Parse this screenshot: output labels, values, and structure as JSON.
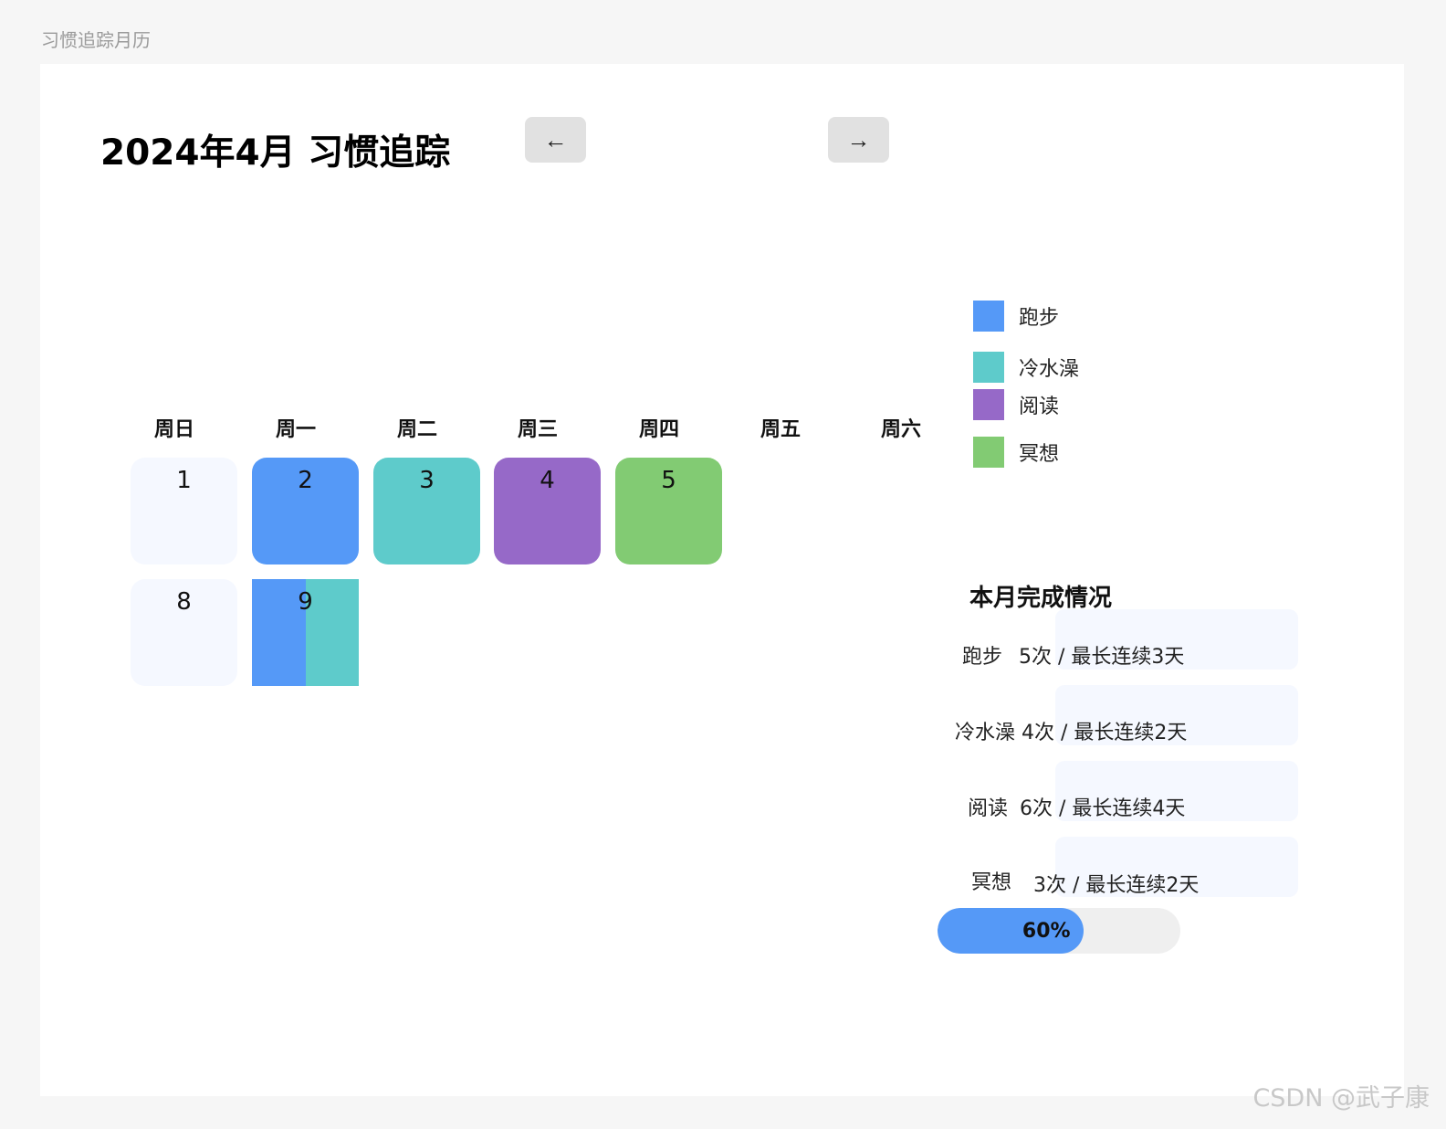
{
  "window_title": "习惯追踪月历",
  "header": {
    "title": "2024年4月 习惯追踪",
    "prev_label": "←",
    "next_label": "→"
  },
  "colors": {
    "running": "#5599f7",
    "cold_shower": "#5ecbcb",
    "reading": "#9669c8",
    "meditation": "#82cb73",
    "progress": "#5599f7"
  },
  "weekdays": [
    "周日",
    "周一",
    "周二",
    "周三",
    "周四",
    "周五",
    "周六"
  ],
  "days": [
    {
      "label": "1"
    },
    {
      "label": "2"
    },
    {
      "label": "3"
    },
    {
      "label": "4"
    },
    {
      "label": "5"
    },
    {
      "label": "8"
    },
    {
      "label": "9"
    }
  ],
  "legend": [
    {
      "label": "跑步"
    },
    {
      "label": "冷水澡"
    },
    {
      "label": "阅读"
    },
    {
      "label": "冥想"
    }
  ],
  "summary": {
    "title": "本月完成情况",
    "stats": [
      {
        "name": "跑步",
        "text": "5次 / 最长连续3天"
      },
      {
        "name": "冷水澡",
        "text": "4次 / 最长连续2天"
      },
      {
        "name": "阅读",
        "text": "6次 / 最长连续4天"
      },
      {
        "name": "冥想",
        "text": "3次 / 最长连续2天"
      }
    ]
  },
  "progress": {
    "percent": 60,
    "label": "60%"
  },
  "watermark": "CSDN @武子康"
}
